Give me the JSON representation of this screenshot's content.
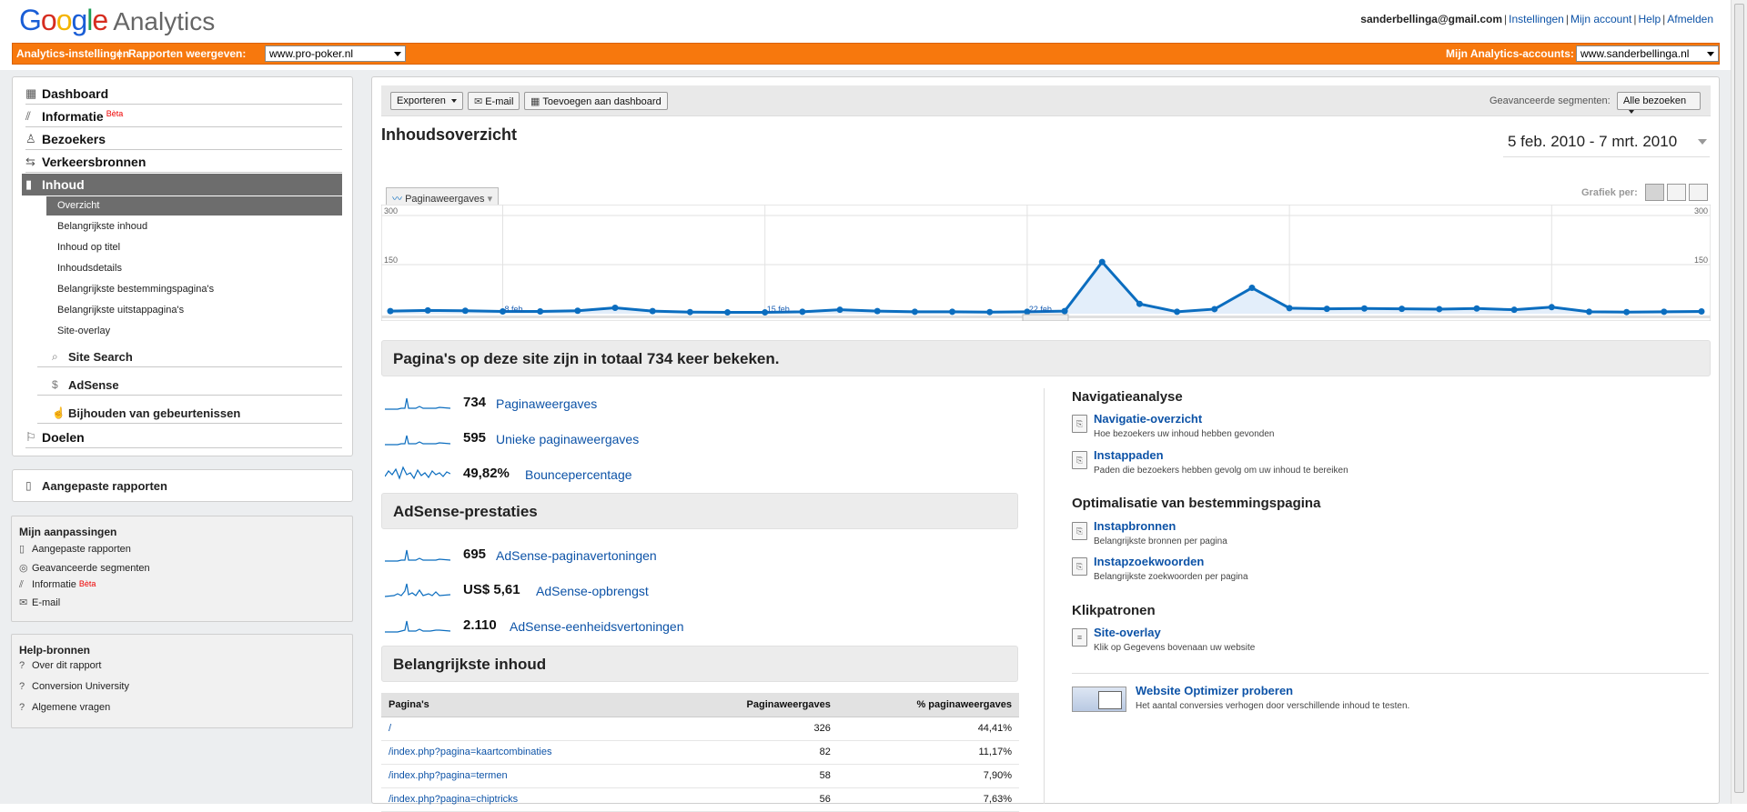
{
  "header": {
    "logo_google": [
      "G",
      "o",
      "o",
      "g",
      "l",
      "e"
    ],
    "logo_product": "Analytics",
    "user_email": "sanderbellinga@gmail.com",
    "links": [
      "Instellingen",
      "Mijn account",
      "Help",
      "Afmelden"
    ]
  },
  "orangebar": {
    "settings_link": "Analytics-instellingen",
    "reports_label": "Rapporten weergeven:",
    "reports_value": "www.pro-poker.nl",
    "accounts_label": "Mijn Analytics-accounts:",
    "accounts_value": "www.sanderbellinga.nl",
    "color": "#f7780d"
  },
  "sidebar": {
    "main": [
      {
        "label": "Dashboard",
        "icon": "grid-icon"
      },
      {
        "label": "Informatie",
        "badge": "Bèta",
        "icon": "chart-icon"
      },
      {
        "label": "Bezoekers",
        "icon": "person-icon"
      },
      {
        "label": "Verkeersbronnen",
        "icon": "traffic-icon"
      },
      {
        "label": "Inhoud",
        "icon": "page-icon"
      }
    ],
    "inhoud_items": [
      "Overzicht",
      "Belangrijkste inhoud",
      "Inhoud op titel",
      "Inhoudsdetails",
      "Belangrijkste bestemmingspagina's",
      "Belangrijkste uitstappagina's",
      "Site-overlay"
    ],
    "sub_groups": [
      "Site Search",
      "AdSense",
      "Bijhouden van gebeurtenissen"
    ],
    "doelen": "Doelen",
    "custom_reports": "Aangepaste rapporten",
    "my_custom": {
      "title": "Mijn aanpassingen",
      "items": [
        "Aangepaste rapporten",
        "Geavanceerde segmenten",
        "Informatie",
        "E-mail"
      ],
      "beta": "Bèta"
    },
    "help": {
      "title": "Help-bronnen",
      "items": [
        "Over dit rapport",
        "Conversion University",
        "Algemene vragen"
      ]
    }
  },
  "toolbar": {
    "export": "Exporteren",
    "email": "E-mail",
    "add_dashboard": "Toevoegen aan dashboard",
    "segments_label": "Geavanceerde segmenten:",
    "segments_value": "Alle bezoeken"
  },
  "page": {
    "title": "Inhoudsoverzicht",
    "date_range": "5 feb. 2010 - 7 mrt. 2010",
    "metric_button": "Paginaweergaves",
    "grafiek_label": "Grafiek per:"
  },
  "chart_data": {
    "type": "area",
    "series": [
      {
        "values": [
          8,
          10,
          9,
          7,
          7,
          9,
          18,
          8,
          5,
          4,
          4,
          6,
          12,
          8,
          6,
          6,
          5,
          6,
          8,
          158,
          30,
          6,
          14,
          79,
          17,
          15,
          16,
          15,
          14,
          16,
          12,
          20,
          6,
          5,
          6,
          7
        ]
      }
    ],
    "x_tick_labels": [
      "8 feb.",
      "15 feb.",
      "22 feb."
    ],
    "y_ticks": [
      150,
      300
    ],
    "ylim": [
      0,
      300
    ],
    "color": "#0b6dbf"
  },
  "summary": {
    "title": "Pagina's op deze site zijn in totaal 734 keer bekeken.",
    "stats": [
      {
        "value": "734",
        "label": "Paginaweergaves"
      },
      {
        "value": "595",
        "label": "Unieke paginaweergaves"
      },
      {
        "value": "49,82%",
        "label": "Bouncepercentage"
      }
    ]
  },
  "adsense": {
    "title": "AdSense-prestaties",
    "stats": [
      {
        "value": "695",
        "label": "AdSense-paginavertoningen"
      },
      {
        "value": "US$ 5,61",
        "label": "AdSense-opbrengst"
      },
      {
        "value": "2.110",
        "label": "AdSense-eenheidsvertoningen"
      }
    ]
  },
  "top_content": {
    "title": "Belangrijkste inhoud",
    "columns": [
      "Pagina's",
      "Paginaweergaves",
      "% paginaweergaves"
    ],
    "rows": [
      [
        "/",
        "326",
        "44,41%"
      ],
      [
        "/index.php?pagina=kaartcombinaties",
        "82",
        "11,17%"
      ],
      [
        "/index.php?pagina=termen",
        "58",
        "7,90%"
      ],
      [
        "/index.php?pagina=chiptricks",
        "56",
        "7,63%"
      ]
    ]
  },
  "right": {
    "nav_title": "Navigatieanalyse",
    "nav_items": [
      {
        "title": "Navigatie-overzicht",
        "desc": "Hoe bezoekers uw inhoud hebben gevonden"
      },
      {
        "title": "Instappaden",
        "desc": "Paden die bezoekers hebben gevolg om uw inhoud te bereiken"
      }
    ],
    "opt_title": "Optimalisatie van bestemmingspagina",
    "opt_items": [
      {
        "title": "Instapbronnen",
        "desc": "Belangrijkste bronnen per pagina"
      },
      {
        "title": "Instapzoekwoorden",
        "desc": "Belangrijkste zoekwoorden per pagina"
      }
    ],
    "click_title": "Klikpatronen",
    "click_items": [
      {
        "title": "Site-overlay",
        "desc": "Klik op Gegevens bovenaan uw website"
      }
    ],
    "optimizer": {
      "title": "Website Optimizer proberen",
      "desc": "Het aantal conversies verhogen door verschillende inhoud te testen."
    }
  }
}
